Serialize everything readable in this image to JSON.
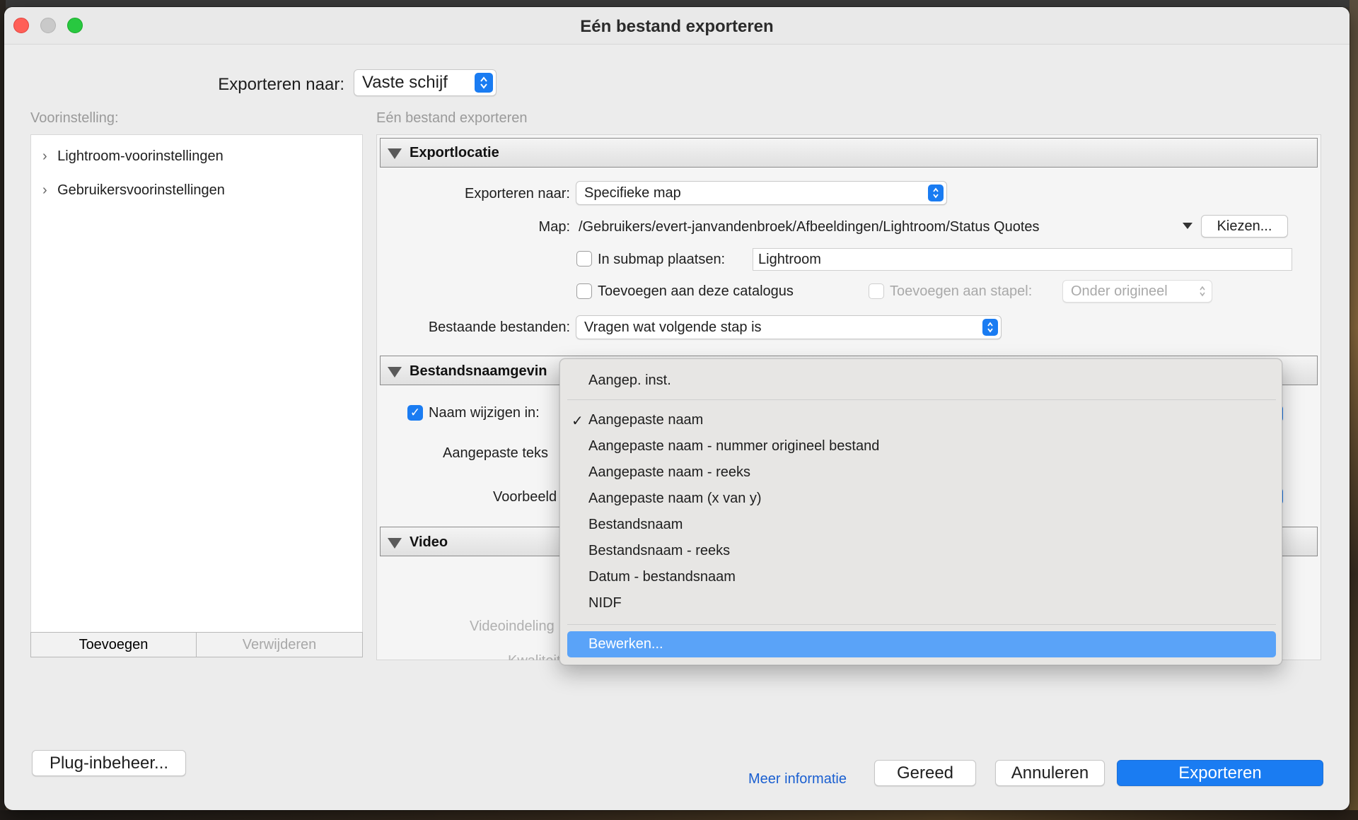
{
  "window": {
    "title": "Eén bestand exporteren"
  },
  "header": {
    "export_to_label": "Exporteren naar:",
    "export_to_value": "Vaste schijf"
  },
  "presets": {
    "label": "Voorinstelling:",
    "items": [
      {
        "label": "Lightroom-voorinstellingen"
      },
      {
        "label": "Gebruikersvoorinstellingen"
      }
    ],
    "add_button": "Toevoegen",
    "remove_button": "Verwijderen"
  },
  "main": {
    "subtitle": "Eén bestand exporteren",
    "export_location": {
      "title": "Exportlocatie",
      "export_to_label": "Exporteren naar:",
      "export_to_value": "Specifieke map",
      "folder_label": "Map:",
      "folder_path": "/Gebruikers/evert-janvandenbroek/Afbeeldingen/Lightroom/Status Quotes",
      "choose_button": "Kiezen...",
      "subfolder_label": "In submap plaatsen:",
      "subfolder_value": "Lightroom",
      "add_catalog_label": "Toevoegen aan deze catalogus",
      "add_stack_label": "Toevoegen aan stapel:",
      "stack_value": "Onder origineel",
      "existing_label": "Bestaande bestanden:",
      "existing_value": "Vragen wat volgende stap is"
    },
    "file_naming": {
      "title": "Bestandsnaamgevin",
      "rename_label": "Naam wijzigen in:",
      "custom_text_label": "Aangepaste teks",
      "example_label": "Voorbeeld"
    },
    "video": {
      "title": "Video",
      "format_label": "Videoindeling",
      "quality_label": "Kwaliteit"
    }
  },
  "dropdown_menu": {
    "header_item": "Aangep. inst.",
    "items": [
      {
        "label": "Aangepaste naam",
        "checked": true
      },
      {
        "label": "Aangepaste naam - nummer origineel bestand"
      },
      {
        "label": "Aangepaste naam - reeks"
      },
      {
        "label": "Aangepaste naam (x van y)"
      },
      {
        "label": "Bestandsnaam"
      },
      {
        "label": "Bestandsnaam - reeks"
      },
      {
        "label": "Datum - bestandsnaam"
      },
      {
        "label": "NIDF"
      }
    ],
    "edit_item": "Bewerken...",
    "check_glyph": "✓"
  },
  "footer": {
    "plugin_button": "Plug-inbeheer...",
    "more_info": "Meer informatie",
    "done_button": "Gereed",
    "cancel_button": "Annuleren",
    "export_button": "Exporteren"
  },
  "colors": {
    "accent": "#1a7cf2",
    "menu_highlight": "#5aa3f8",
    "link": "#1a5fd0"
  }
}
